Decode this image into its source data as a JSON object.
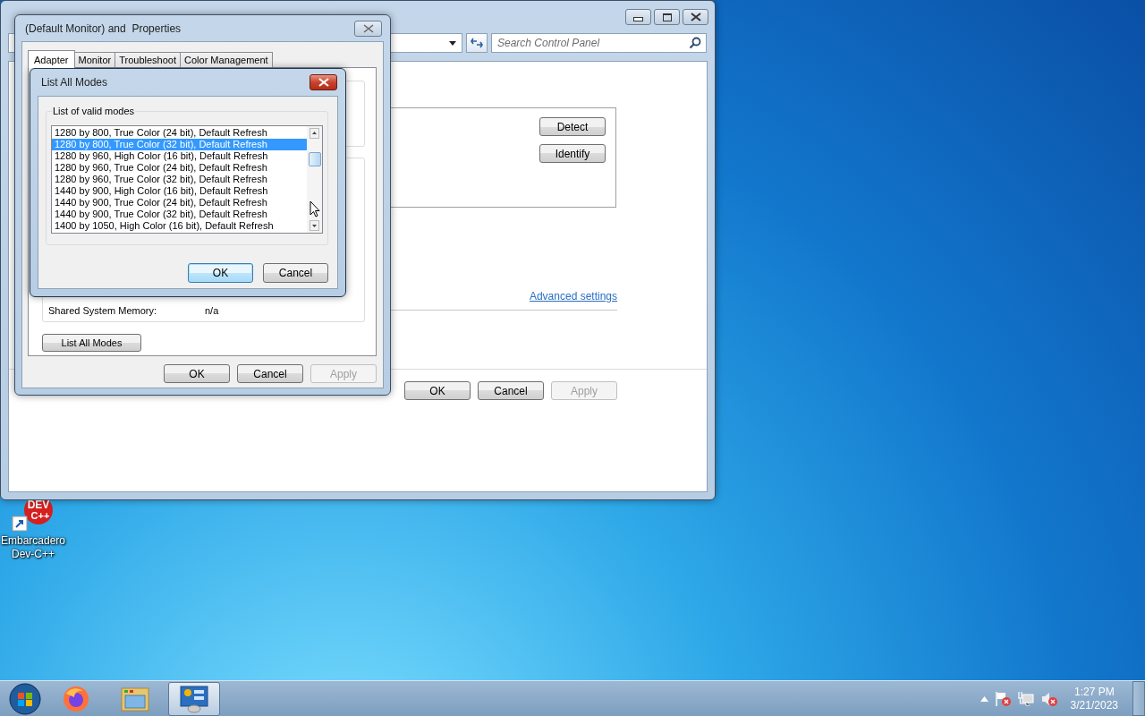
{
  "control_panel_window": {
    "search": {
      "placeholder": "Search Control Panel"
    },
    "display_buttons": [
      {
        "label": "Detect",
        "disabled": false
      },
      {
        "label": "Identify",
        "disabled": false
      }
    ],
    "link": "Advanced settings",
    "footer_buttons": [
      {
        "label": "OK",
        "disabled": false
      },
      {
        "label": "Cancel",
        "disabled": false
      },
      {
        "label": "Apply",
        "disabled": true
      }
    ]
  },
  "properties_dialog": {
    "title": "(Default Monitor) and  Properties",
    "tabs": [
      {
        "label": "Adapter",
        "selected": true
      },
      {
        "label": "Monitor",
        "selected": false
      },
      {
        "label": "Troubleshoot",
        "selected": false
      },
      {
        "label": "Color Management",
        "selected": false
      }
    ],
    "shared_memory": {
      "label": "Shared System Memory:",
      "value": "n/a"
    },
    "list_all_modes_button": "List All Modes",
    "footer_buttons": [
      {
        "label": "OK",
        "disabled": false
      },
      {
        "label": "Cancel",
        "disabled": false
      },
      {
        "label": "Apply",
        "disabled": true
      }
    ]
  },
  "list_modes_dialog": {
    "title": "List All Modes",
    "group_label": "List of valid modes",
    "modes": [
      {
        "label": "1280 by 800, True Color (24 bit), Default Refresh",
        "selected": false
      },
      {
        "label": "1280 by 800, True Color (32 bit), Default Refresh",
        "selected": true
      },
      {
        "label": "1280 by 960, High Color (16 bit), Default Refresh",
        "selected": false
      },
      {
        "label": "1280 by 960, True Color (24 bit), Default Refresh",
        "selected": false
      },
      {
        "label": "1280 by 960, True Color (32 bit), Default Refresh",
        "selected": false
      },
      {
        "label": "1440 by 900, High Color (16 bit), Default Refresh",
        "selected": false
      },
      {
        "label": "1440 by 900, True Color (24 bit), Default Refresh",
        "selected": false
      },
      {
        "label": "1440 by 900, True Color (32 bit), Default Refresh",
        "selected": false
      },
      {
        "label": "1400 by 1050, High Color (16 bit), Default Refresh",
        "selected": false
      }
    ],
    "buttons": [
      {
        "label": "OK",
        "default": true
      },
      {
        "label": "Cancel",
        "default": false
      }
    ]
  },
  "desktop_icons": [
    {
      "label": "Embarcadero Dev-C++",
      "icon_text": [
        "DEV",
        "C++"
      ]
    }
  ],
  "taskbar": {
    "apps": [
      {
        "kind": "firefox",
        "selected": false
      },
      {
        "kind": "explorer",
        "selected": false
      },
      {
        "kind": "control-panel",
        "selected": true
      }
    ],
    "clock": {
      "time": "1:27 PM",
      "date": "3/21/2023"
    }
  }
}
